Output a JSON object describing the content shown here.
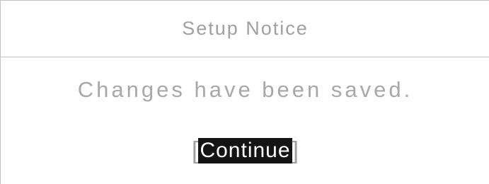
{
  "dialog": {
    "title": "Setup Notice",
    "message": "Changes have been saved.",
    "button": {
      "left_bracket": "[",
      "label": "Continue",
      "right_bracket": "]"
    }
  },
  "colors": {
    "background": "#ffffff",
    "text": "#a0a0a0",
    "border": "#c0c0c0",
    "button_bg": "#141414",
    "button_text": "#ffffff"
  }
}
